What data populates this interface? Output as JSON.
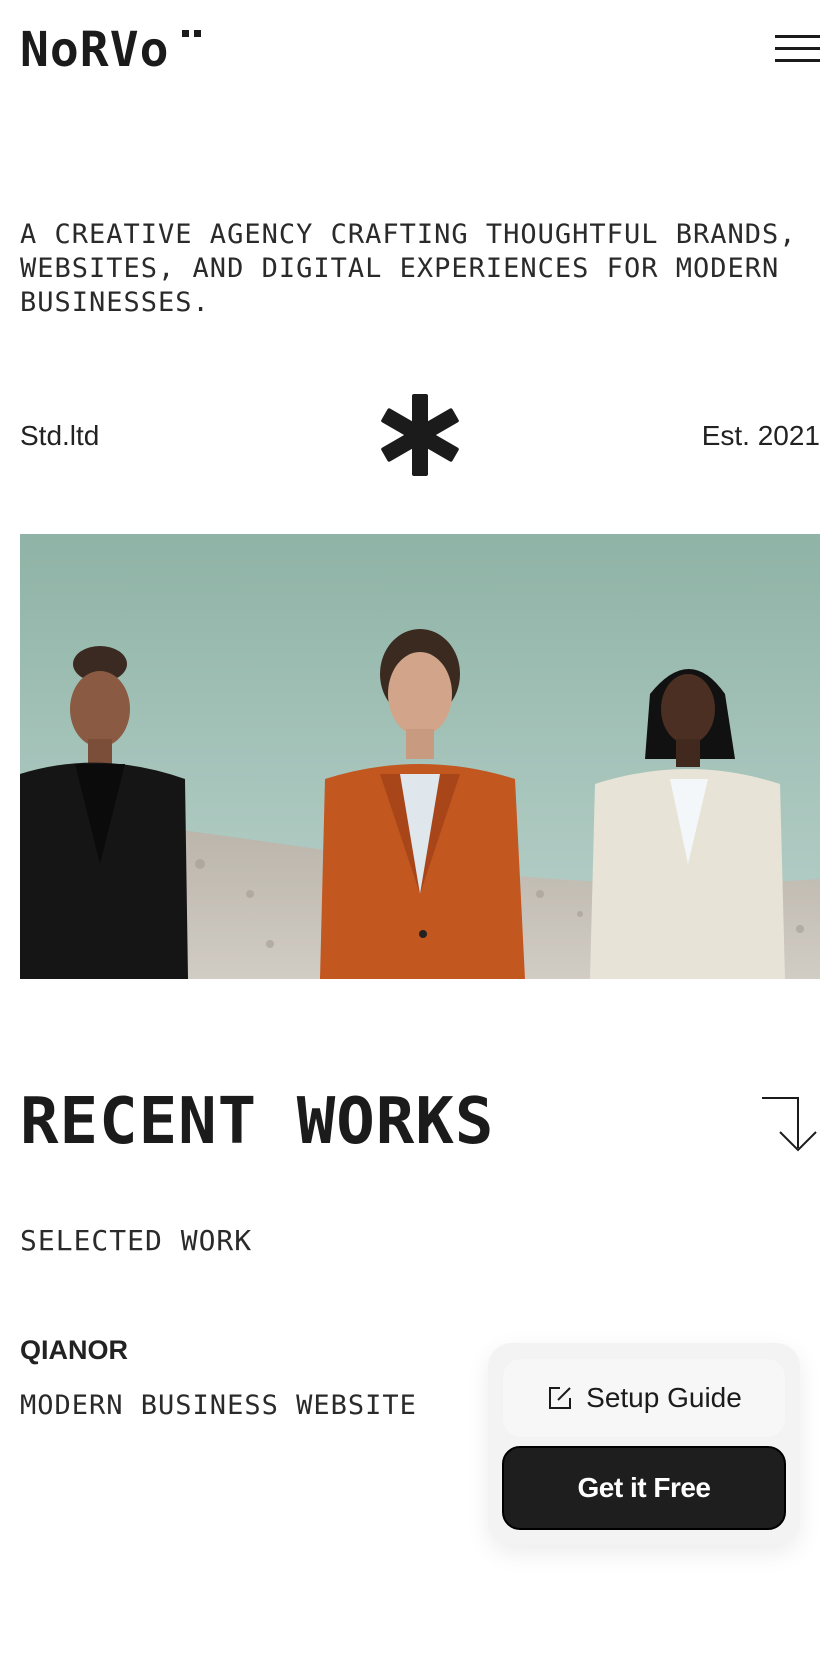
{
  "header": {
    "logo_text": "NoRVo",
    "menu_icon": "hamburger-menu-icon"
  },
  "intro": {
    "text": "A CREATIVE AGENCY CRAFTING THOUGHTFUL BRANDS, WEBSITES, AND DIGITAL EXPERIENCES FOR MODERN BUSINESSES."
  },
  "meta": {
    "left": "Std.ltd",
    "center_icon": "asterisk-icon",
    "right": "Est. 2021"
  },
  "hero": {
    "image": "hero-photo"
  },
  "works": {
    "title": "RECENT WORKS",
    "arrow_icon": "arrow-down-right-icon",
    "subtitle": "SELECTED WORK",
    "project_name": "QIANOR",
    "project_desc": "MODERN BUSINESS WEBSITE"
  },
  "cta": {
    "setup_label": "Setup Guide",
    "setup_icon": "edit-icon",
    "free_label": "Get it Free"
  },
  "colors": {
    "text": "#1b1b1b",
    "background": "#ffffff",
    "button_dark": "#1e1e1e",
    "card": "#f3f3f3"
  }
}
